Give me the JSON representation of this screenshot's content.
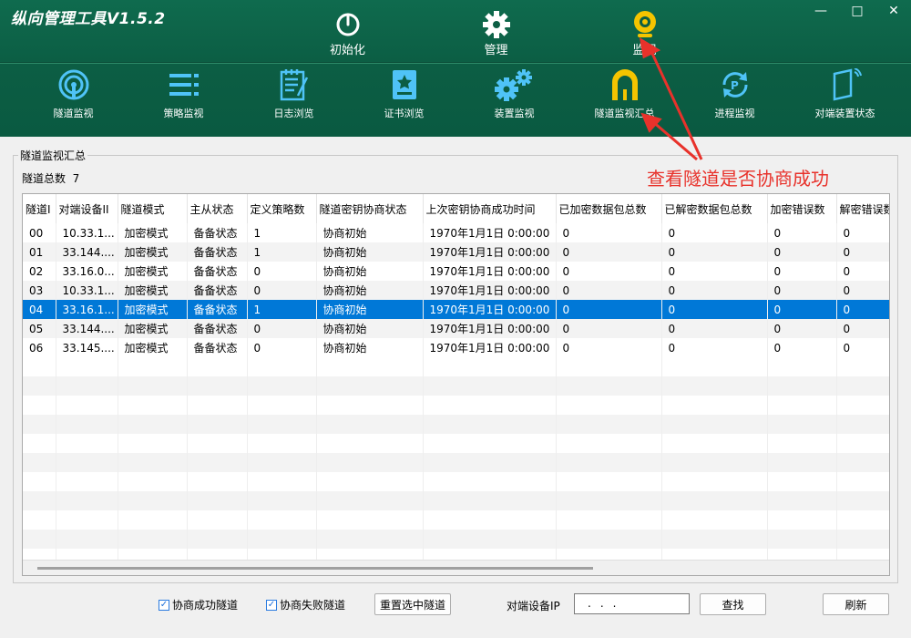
{
  "window": {
    "title": "纵向管理工具V1.5.2",
    "controls": [
      "minimize",
      "maximize",
      "close"
    ]
  },
  "main_nav": [
    {
      "label": "初始化",
      "icon": "power-icon"
    },
    {
      "label": "管理",
      "icon": "gear-icon"
    },
    {
      "label": "监视",
      "icon": "webcam-icon",
      "active": true
    }
  ],
  "sub_nav": [
    {
      "label": "隧道监视",
      "icon": "signal-icon"
    },
    {
      "label": "策略监视",
      "icon": "list-icon"
    },
    {
      "label": "日志浏览",
      "icon": "notepad-icon"
    },
    {
      "label": "证书浏览",
      "icon": "certificate-icon"
    },
    {
      "label": "装置监视",
      "icon": "gears-icon"
    },
    {
      "label": "隧道监视汇总",
      "icon": "tunnel-icon",
      "active": true
    },
    {
      "label": "进程监视",
      "icon": "refresh-process-icon"
    },
    {
      "label": "对端装置状态",
      "icon": "device-status-icon"
    }
  ],
  "panel": {
    "group_title": "隧道监视汇总",
    "count_label": "隧道总数",
    "count_value": "7"
  },
  "table": {
    "columns": [
      "隧道I",
      "对端设备II",
      "隧道模式",
      "主从状态",
      "定义策略数",
      "隧道密钥协商状态",
      "上次密钥协商成功时间",
      "已加密数据包总数",
      "已解密数据包总数",
      "加密错误数",
      "解密错误数"
    ],
    "rows": [
      [
        "00",
        "10.33.1...",
        "加密模式",
        "备备状态",
        "1",
        "协商初始",
        "1970年1月1日 0:00:00",
        "0",
        "0",
        "0",
        "0"
      ],
      [
        "01",
        "33.144....",
        "加密模式",
        "备备状态",
        "1",
        "协商初始",
        "1970年1月1日 0:00:00",
        "0",
        "0",
        "0",
        "0"
      ],
      [
        "02",
        "33.16.0...",
        "加密模式",
        "备备状态",
        "0",
        "协商初始",
        "1970年1月1日 0:00:00",
        "0",
        "0",
        "0",
        "0"
      ],
      [
        "03",
        "10.33.1...",
        "加密模式",
        "备备状态",
        "0",
        "协商初始",
        "1970年1月1日 0:00:00",
        "0",
        "0",
        "0",
        "0"
      ],
      [
        "04",
        "33.16.1...",
        "加密模式",
        "备备状态",
        "1",
        "协商初始",
        "1970年1月1日 0:00:00",
        "0",
        "0",
        "0",
        "0"
      ],
      [
        "05",
        "33.144....",
        "加密模式",
        "备备状态",
        "0",
        "协商初始",
        "1970年1月1日 0:00:00",
        "0",
        "0",
        "0",
        "0"
      ],
      [
        "06",
        "33.145....",
        "加密模式",
        "备备状态",
        "0",
        "协商初始",
        "1970年1月1日 0:00:00",
        "0",
        "0",
        "0",
        "0"
      ]
    ],
    "selected_row": 4
  },
  "bottom": {
    "chk_success_label": "协商成功隧道",
    "chk_fail_label": "协商失败隧道",
    "reset_button": "重置选中隧道",
    "ip_label": "对端设备IP",
    "ip_value": "...",
    "search_button": "查找",
    "refresh_button": "刷新"
  },
  "annotation": {
    "text": "查看隧道是否协商成功",
    "color": "#e8322b"
  },
  "colors": {
    "header_bg": "#0c5e44",
    "selected_row": "#0078d7",
    "active_icon": "#f5c400"
  }
}
